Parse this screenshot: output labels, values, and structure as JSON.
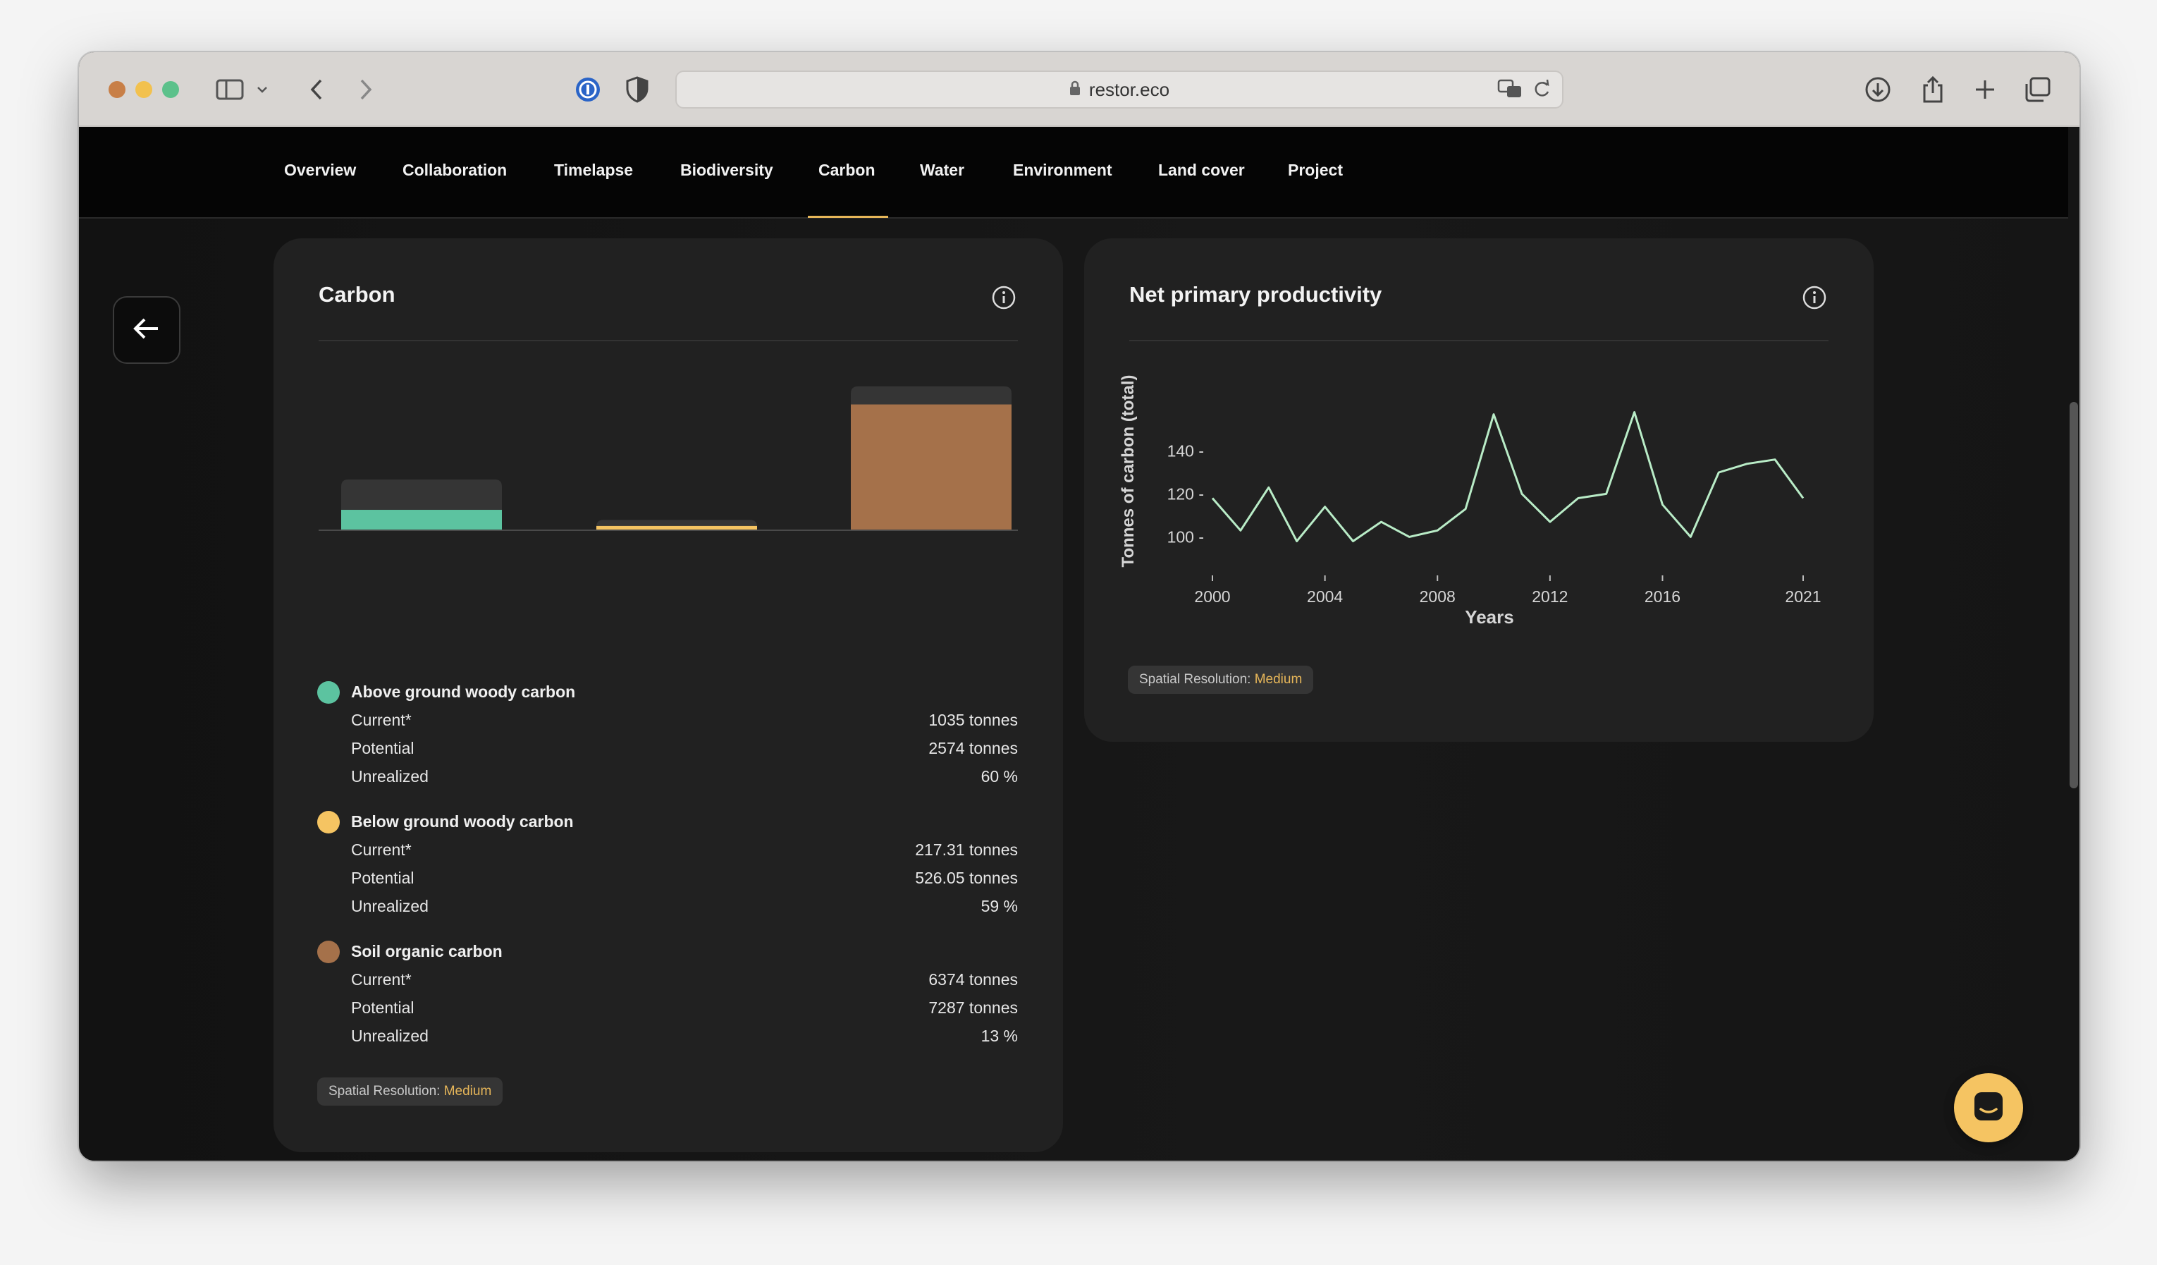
{
  "browser": {
    "url": "restor.eco",
    "traffic_colors": [
      "#c87f47",
      "#f2c14e",
      "#5cc18b"
    ]
  },
  "tabs": [
    {
      "label": "Overview"
    },
    {
      "label": "Collaboration"
    },
    {
      "label": "Timelapse"
    },
    {
      "label": "Biodiversity"
    },
    {
      "label": "Carbon",
      "active": true
    },
    {
      "label": "Water"
    },
    {
      "label": "Environment"
    },
    {
      "label": "Land cover"
    },
    {
      "label": "Project"
    }
  ],
  "carbon_card": {
    "title": "Carbon",
    "groups": [
      {
        "name": "Above ground woody carbon",
        "color": "#5cc3a0",
        "rows": [
          {
            "label": "Current*",
            "value": "1035 tonnes"
          },
          {
            "label": "Potential",
            "value": "2574 tonnes"
          },
          {
            "label": "Unrealized",
            "value": "60 %"
          }
        ]
      },
      {
        "name": "Below ground woody carbon",
        "color": "#f5c462",
        "rows": [
          {
            "label": "Current*",
            "value": "217.31 tonnes"
          },
          {
            "label": "Potential",
            "value": "526.05 tonnes"
          },
          {
            "label": "Unrealized",
            "value": "59 %"
          }
        ]
      },
      {
        "name": "Soil organic carbon",
        "color": "#a5714a",
        "rows": [
          {
            "label": "Current*",
            "value": "6374 tonnes"
          },
          {
            "label": "Potential",
            "value": "7287 tonnes"
          },
          {
            "label": "Unrealized",
            "value": "13 %"
          }
        ]
      }
    ],
    "badge_label": "Spatial Resolution: ",
    "badge_value": "Medium"
  },
  "npp_card": {
    "title": "Net primary productivity",
    "badge_label": "Spatial Resolution: ",
    "badge_value": "Medium"
  },
  "chart_data": [
    {
      "type": "bar",
      "title": "Carbon",
      "categories": [
        "Above ground woody carbon",
        "Below ground woody carbon",
        "Soil organic carbon"
      ],
      "series": [
        {
          "name": "Current*",
          "values": [
            1035,
            217.31,
            6374
          ]
        },
        {
          "name": "Potential",
          "values": [
            2574,
            526.05,
            7287
          ]
        }
      ],
      "colors": [
        "#5cc3a0",
        "#f5c462",
        "#a5714a"
      ],
      "potential_color": "#353535",
      "ylim": [
        0,
        7287
      ]
    },
    {
      "type": "line",
      "title": "Net primary productivity",
      "xlabel": "Years",
      "ylabel": "Tonnes of carbon (total)",
      "x": [
        2000,
        2001,
        2002,
        2003,
        2004,
        2005,
        2006,
        2007,
        2008,
        2009,
        2010,
        2011,
        2012,
        2013,
        2014,
        2015,
        2016,
        2017,
        2018,
        2019,
        2020,
        2021
      ],
      "values": [
        118,
        103,
        123,
        98,
        114,
        98,
        107,
        100,
        103,
        113,
        157,
        120,
        107,
        118,
        120,
        158,
        115,
        100,
        130,
        134,
        136,
        118
      ],
      "xticks": [
        "2000",
        "2004",
        "2008",
        "2012",
        "2016",
        "2021"
      ],
      "xtick_values": [
        2000,
        2004,
        2008,
        2012,
        2016,
        2021
      ],
      "yticks": [
        "100 -",
        "120 -",
        "140 -"
      ],
      "ytick_values": [
        100,
        120,
        140
      ],
      "xlim": [
        2000,
        2021
      ],
      "ylim": [
        88,
        170
      ],
      "line_color": "#b9ecc7",
      "grid": false
    }
  ]
}
